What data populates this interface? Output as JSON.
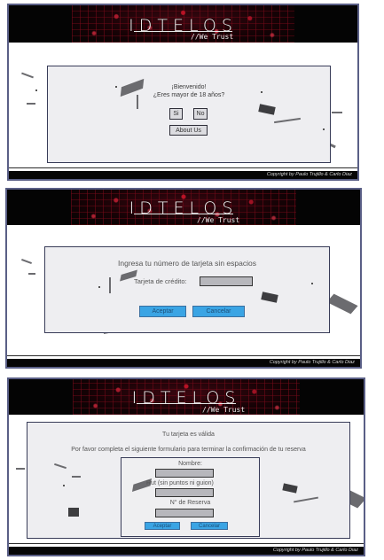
{
  "brand": {
    "logo": "IDTELOS",
    "tagline": "//We Trust",
    "copyright": "Copyright by Paulo Trujillo & Carlo Diaz"
  },
  "screen1": {
    "welcome": "¡Bienvenido!",
    "question": "¿Eres mayor de 18 años?",
    "yes_label": "Si",
    "no_label": "No",
    "about_label": "About Us"
  },
  "screen2": {
    "heading": "Ingresa tu número de tarjeta sin espacios",
    "card_label": "Tarjeta de crédito:",
    "card_value": "",
    "accept_label": "Aceptar",
    "cancel_label": "Cancelar"
  },
  "screen3": {
    "valid_text": "Tu tarjeta es válida",
    "instruction": "Por favor completa el siguiente formulario para terminar la confirmación de tu reserva",
    "name_label": "Nombre:",
    "name_value": "",
    "rut_label": "Rut (sin puntos ni guion)",
    "rut_value": "",
    "reserve_label": "N° de Reserva",
    "reserve_value": "",
    "accept_label": "Aceptar",
    "cancel_label": "Cancelar"
  },
  "colors": {
    "accent_blue": "#3aa4e4",
    "banner_red": "#b01830",
    "frame_border": "#383c58"
  }
}
